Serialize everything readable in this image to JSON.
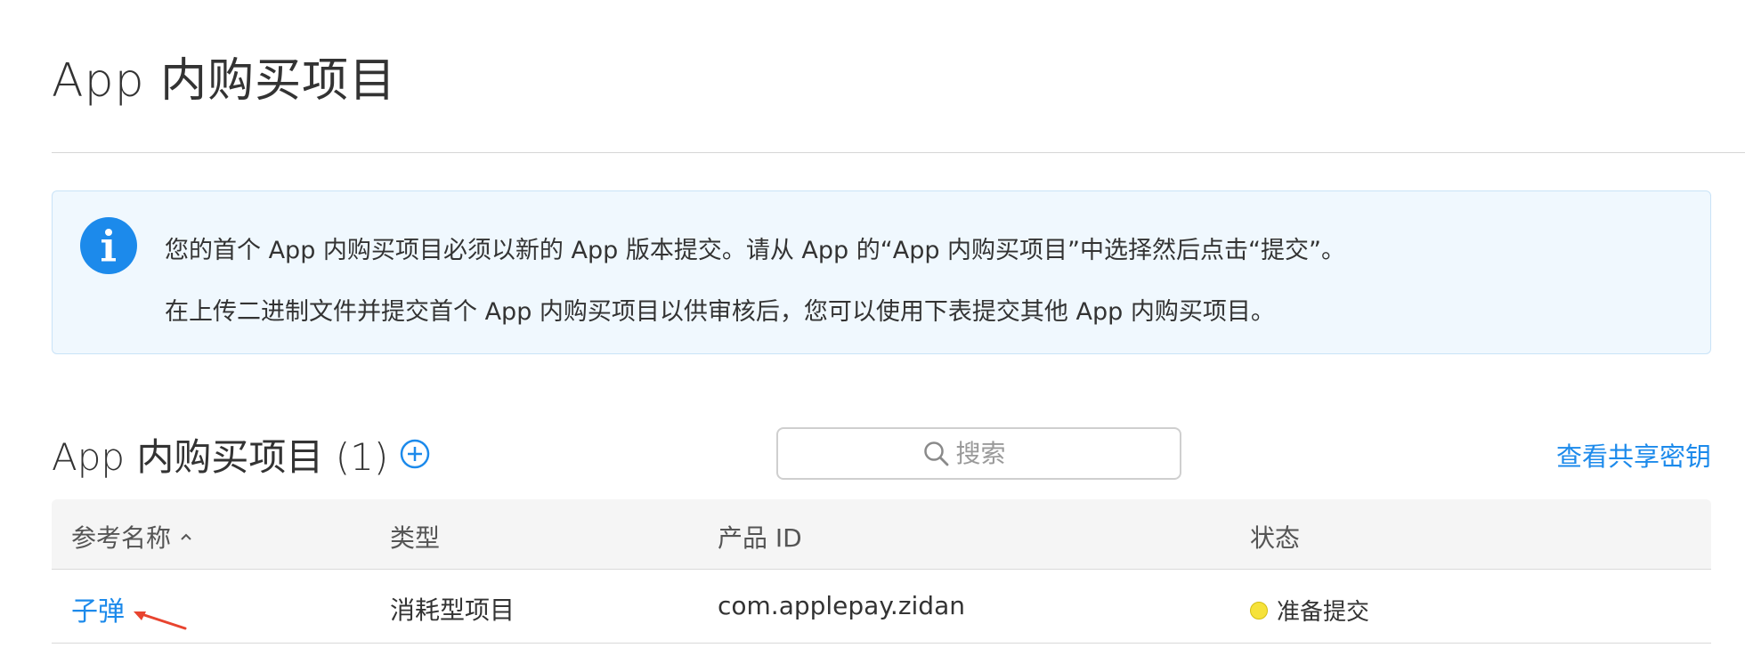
{
  "page": {
    "title": "App 内购买项目"
  },
  "banner": {
    "icon": "info-icon",
    "line1": "您的首个 App 内购买项目必须以新的 App 版本提交。请从 App 的“App 内购买项目”中选择然后点击“提交”。",
    "line2": "在上传二进制文件并提交首个 App 内购买项目以供审核后，您可以使用下表提交其他 App 内购买项目。"
  },
  "section": {
    "title": "App 内购买项目 (1)",
    "add_icon": "plus-circle-icon",
    "search_placeholder": "搜索",
    "search_value": "",
    "shared_secret_link": "查看共享密钥"
  },
  "table": {
    "columns": [
      "参考名称",
      "类型",
      "产品 ID",
      "状态"
    ],
    "sort_icon": "chevron-up-icon",
    "rows": [
      {
        "name": "子弹",
        "type": "消耗型项目",
        "product_id": "com.applepay.zidan",
        "status": "准备提交"
      }
    ]
  },
  "colors": {
    "accent": "#1c8aeb",
    "banner_bg": "#f0f8fe",
    "status_ready": "#f6e23a",
    "annotation": "#e8442f"
  }
}
